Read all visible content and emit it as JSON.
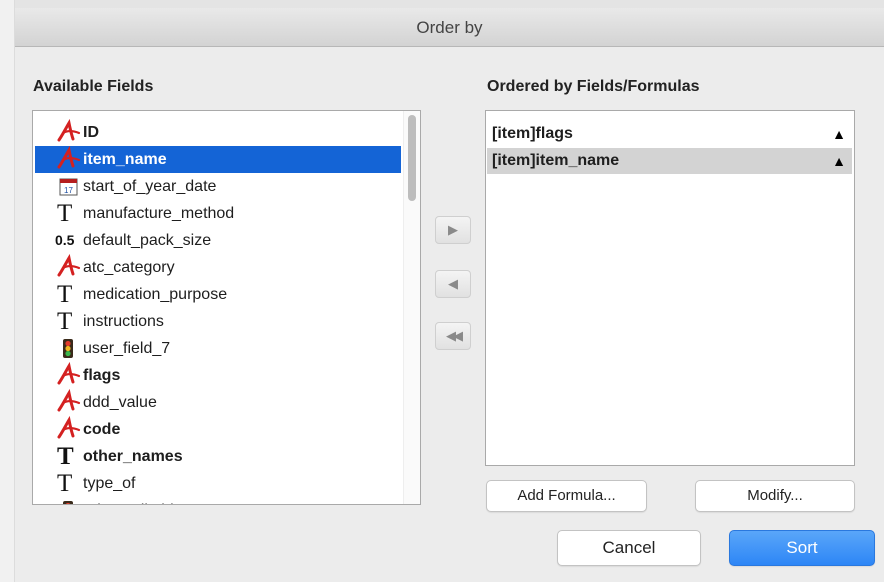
{
  "dialog": {
    "title": "Order by"
  },
  "available": {
    "label": "Available Fields",
    "items": [
      {
        "label": "ID",
        "icon": "red-script-a-icon",
        "bold": true,
        "selected": false
      },
      {
        "label": "item_name",
        "icon": "red-script-a-icon",
        "bold": true,
        "selected": true
      },
      {
        "label": "start_of_year_date",
        "icon": "calendar-icon",
        "calendar_day": "17",
        "bold": false,
        "selected": false
      },
      {
        "label": "manufacture_method",
        "icon": "text-t-icon",
        "bold": false,
        "selected": false
      },
      {
        "label": "default_pack_size",
        "icon": "number-icon",
        "icon_text": "0.5",
        "bold": false,
        "selected": false
      },
      {
        "label": "atc_category",
        "icon": "red-script-a-icon",
        "bold": false,
        "selected": false
      },
      {
        "label": "medication_purpose",
        "icon": "text-t-icon",
        "bold": false,
        "selected": false
      },
      {
        "label": "instructions",
        "icon": "text-t-icon",
        "bold": false,
        "selected": false
      },
      {
        "label": "user_field_7",
        "icon": "traffic-light-icon",
        "bold": false,
        "selected": false
      },
      {
        "label": "flags",
        "icon": "red-script-a-icon",
        "bold": true,
        "selected": false
      },
      {
        "label": "ddd_value",
        "icon": "red-script-a-icon",
        "bold": false,
        "selected": false
      },
      {
        "label": "code",
        "icon": "red-script-a-icon",
        "bold": true,
        "selected": false
      },
      {
        "label": "other_names",
        "icon": "text-t-icon",
        "bold": true,
        "selected": false
      },
      {
        "label": "type_of",
        "icon": "text-t-icon",
        "bold": false,
        "selected": false
      },
      {
        "label": "price_editable",
        "icon": "traffic-light-icon",
        "bold": false,
        "selected": false
      }
    ]
  },
  "transfer": {
    "add_icon": "arrow-right-icon",
    "remove_icon": "arrow-left-icon",
    "remove_all_icon": "double-arrow-left-icon"
  },
  "ordered": {
    "label": "Ordered by Fields/Formulas",
    "items": [
      {
        "label": "[item]flags",
        "direction_icon": "sort-ascending-triangle-icon",
        "selected": false
      },
      {
        "label": "[item]item_name",
        "direction_icon": "sort-ascending-triangle-icon",
        "selected": true
      }
    ]
  },
  "buttons": {
    "add_formula": "Add Formula...",
    "modify": "Modify...",
    "cancel": "Cancel",
    "sort": "Sort"
  },
  "colors": {
    "selection_blue": "#1464d6",
    "field_icon_red": "#d42121",
    "primary_button": "#2d86f6",
    "ordered_selection": "#d3d3d3"
  }
}
